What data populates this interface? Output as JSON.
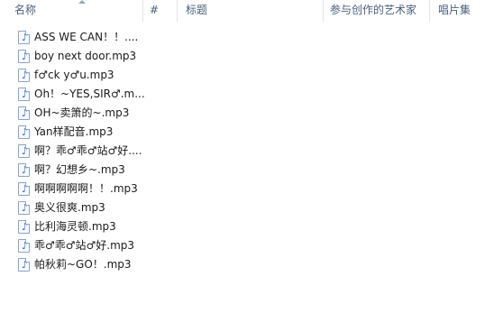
{
  "columns": {
    "name": "名称",
    "number": "#",
    "title": "标题",
    "artist": "参与创作的艺术家",
    "album": "唱片集"
  },
  "file_icon": "music-file-icon",
  "files": [
    "ASS WE CAN！！....",
    "boy next door.mp3",
    "f♂ck y♂u.mp3",
    "Oh！~YES,SIR♂.m...",
    "OH~卖箫的~.mp3",
    "Yan样配音.mp3",
    "啊？乖♂乖♂站♂好....",
    "啊？幻想乡~.mp3",
    "啊啊啊啊啊！！.mp3",
    "奥义很爽.mp3",
    "比利海灵顿.mp3",
    "乖♂乖♂站♂好.mp3",
    "帕秋莉~GO！.mp3"
  ]
}
